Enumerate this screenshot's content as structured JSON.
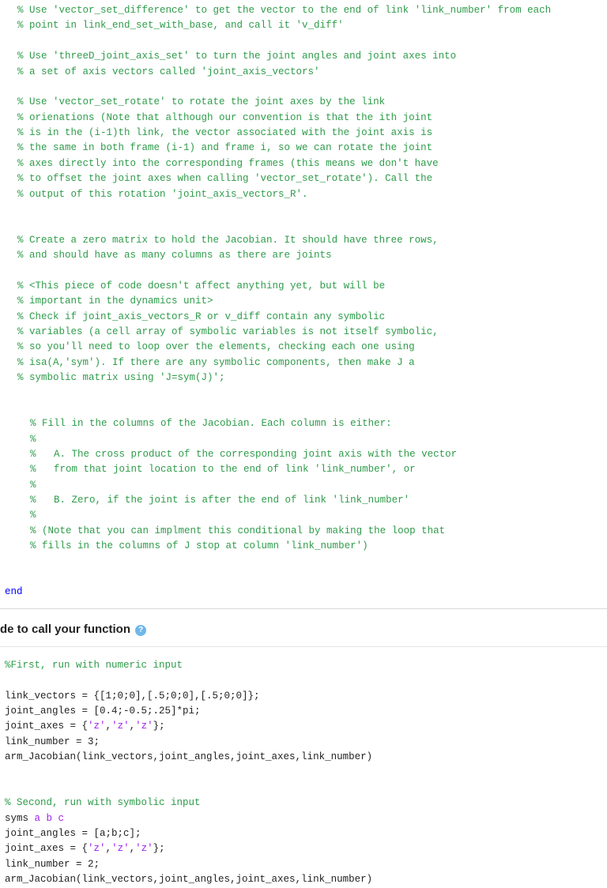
{
  "code1": {
    "l01": "% Use 'vector_set_difference' to get the vector to the end of link 'link_number' from each",
    "l02": "% point in link_end_set_with_base, and call it 'v_diff'",
    "l03": "% Use 'threeD_joint_axis_set' to turn the joint angles and joint axes into",
    "l04": "% a set of axis vectors called 'joint_axis_vectors'",
    "l05": "% Use 'vector_set_rotate' to rotate the joint axes by the link",
    "l06": "% orienations (Note that although our convention is that the ith joint",
    "l07": "% is in the (i-1)th link, the vector associated with the joint axis is",
    "l08": "% the same in both frame (i-1) and frame i, so we can rotate the joint",
    "l09": "% axes directly into the corresponding frames (this means we don't have",
    "l10": "% to offset the joint axes when calling 'vector_set_rotate'). Call the",
    "l11": "% output of this rotation 'joint_axis_vectors_R'.",
    "l12": "% Create a zero matrix to hold the Jacobian. It should have three rows,",
    "l13": "% and should have as many columns as there are joints",
    "l14": "% <This piece of code doesn't affect anything yet, but will be",
    "l15": "% important in the dynamics unit>",
    "l16": "% Check if joint_axis_vectors_R or v_diff contain any symbolic",
    "l17": "% variables (a cell array of symbolic variables is not itself symbolic,",
    "l18": "% so you'll need to loop over the elements, checking each one using",
    "l19": "% isa(A,'sym'). If there are any symbolic components, then make J a",
    "l20": "% symbolic matrix using 'J=sym(J)';",
    "l21": "% Fill in the columns of the Jacobian. Each column is either:",
    "l22": "%",
    "l23": "%   A. The cross product of the corresponding joint axis with the vector",
    "l24": "%   from that joint location to the end of link 'link_number', or",
    "l25": "%",
    "l26": "%   B. Zero, if the joint is after the end of link 'link_number'",
    "l27": "%",
    "l28": "% (Note that you can implment this conditional by making the loop that",
    "l29": "% fills in the columns of J stop at column 'link_number')",
    "end": "end"
  },
  "section": {
    "title": "de to call your function",
    "help": "?"
  },
  "code2": {
    "c01": "%First, run with numeric input",
    "p02": "link_vectors = {[1;0;0],[.5;0;0],[.5;0;0]};",
    "p03": "joint_angles = [0.4;-0.5;.25]*pi;",
    "p04a": "joint_axes = {",
    "p04b": "'z'",
    "p04c": ",",
    "p04d": "'z'",
    "p04e": ",",
    "p04f": "'z'",
    "p04g": "};",
    "p05": "link_number = 3;",
    "p06": "arm_Jacobian(link_vectors,joint_angles,joint_axes,link_number)",
    "c07": "% Second, run with symbolic input",
    "p08a": "syms ",
    "p08b": "a b c",
    "p09": "joint_angles = [a;b;c];",
    "p10a": "joint_axes = {",
    "p10b": "'z'",
    "p10c": ",",
    "p10d": "'z'",
    "p10e": ",",
    "p10f": "'z'",
    "p10g": "};",
    "p11": "link_number = 2;",
    "p12": "arm_Jacobian(link_vectors,joint_angles,joint_axes,link_number)"
  }
}
